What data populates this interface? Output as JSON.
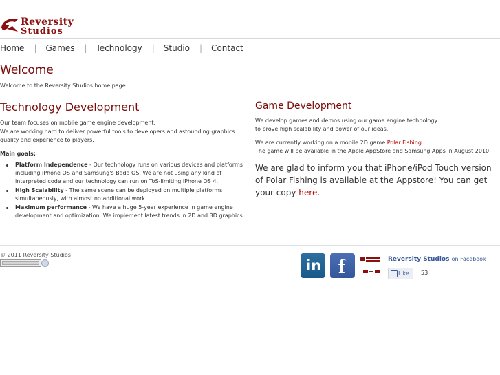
{
  "logo": {
    "line1": "Reversity",
    "line2": "Studios"
  },
  "nav": {
    "items": [
      "Home",
      "Games",
      "Technology",
      "Studio",
      "Contact"
    ]
  },
  "welcome": {
    "title": "Welcome",
    "text": "Welcome to the Reversity Studios home page."
  },
  "technology": {
    "title": "Technology Development",
    "line1": "Our team focuses on mobile game engine development.",
    "line2": "We are working hard to deliver powerful tools to developers and astounding graphics quality and experience to players.",
    "goals_label": "Main goals:",
    "goals": [
      {
        "name": "Platform Independence",
        "text": " - Our technology runs on various devices and platforms including iPhone OS and Samsung's Bada OS. We are not using any kind of interpreted code and our technology can run on ToS-limiting iPhone OS 4."
      },
      {
        "name": "High Scalability",
        "text": " - The same scene can be deployed on multiple platforms simultaneously, with almost no additional work."
      },
      {
        "name": "Maximum performance",
        "text": " - We have a huge 5-year experience in game engine development and optimization. We implement latest trends in 2D and 3D graphics."
      }
    ]
  },
  "game": {
    "title": "Game Development",
    "p1_line1": "We develop games and demos using our game engine technology",
    "p1_line2": "to prove high scalability and power of our ideas.",
    "p2_before": "We are currently working on a mobile 2D game ",
    "p2_link": "Polar Fishing",
    "p2_after": ".",
    "p2_line2": "The game will be available in the Apple AppStore and Samsung Apps in August 2010.",
    "glad_before": "We are glad to inform you that iPhone/iPod Touch version of Polar Fishing is available at the Appstore! You can get your copy ",
    "glad_link": "here",
    "glad_after": "."
  },
  "footer": {
    "copyright": "© 2011 Reversity Studios",
    "linkedin_label": "in",
    "facebook_label": "f",
    "fb_page_name": "Reversity Studios",
    "fb_on": "on Facebook",
    "like_label": "Like",
    "like_count": "53"
  },
  "colors": {
    "accent": "#7a0a0a",
    "link": "#b40000",
    "facebook": "#3b5998",
    "linkedin": "#1f6396"
  }
}
